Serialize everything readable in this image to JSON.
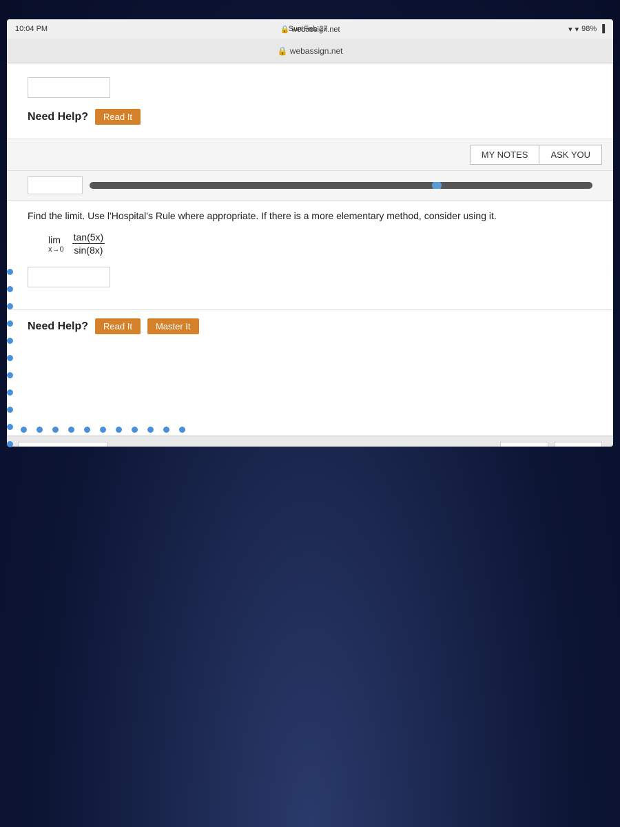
{
  "status_bar": {
    "time": "10:04 PM",
    "date": "Sun Feb 27",
    "url": "webassign.net",
    "battery": "98%",
    "wifi": "▾"
  },
  "header": {
    "my_notes_label": "MY NOTES",
    "ask_you_label": "ASK YOU"
  },
  "top_section": {
    "need_help_label": "Need Help?",
    "read_it_label": "Read It"
  },
  "question": {
    "instruction": "Find the limit. Use l'Hospital's Rule where appropriate. If there is a more elementary method, consider using it.",
    "limit_word": "lim",
    "limit_subscript": "x→0",
    "numerator": "tan(5x)",
    "denominator": "sin(8x)"
  },
  "bottom_section": {
    "need_help_label": "Need Help?",
    "read_it_label": "Read It",
    "master_it_label": "Master It"
  },
  "side_dots": [
    "•",
    "•",
    "•",
    "•",
    "•",
    "•",
    "•",
    "•",
    "•",
    "•",
    "•"
  ],
  "row_dots": [
    "•",
    "•",
    "•",
    "•",
    "•",
    "•",
    "•",
    "•",
    "•",
    "•",
    "•",
    "•"
  ]
}
